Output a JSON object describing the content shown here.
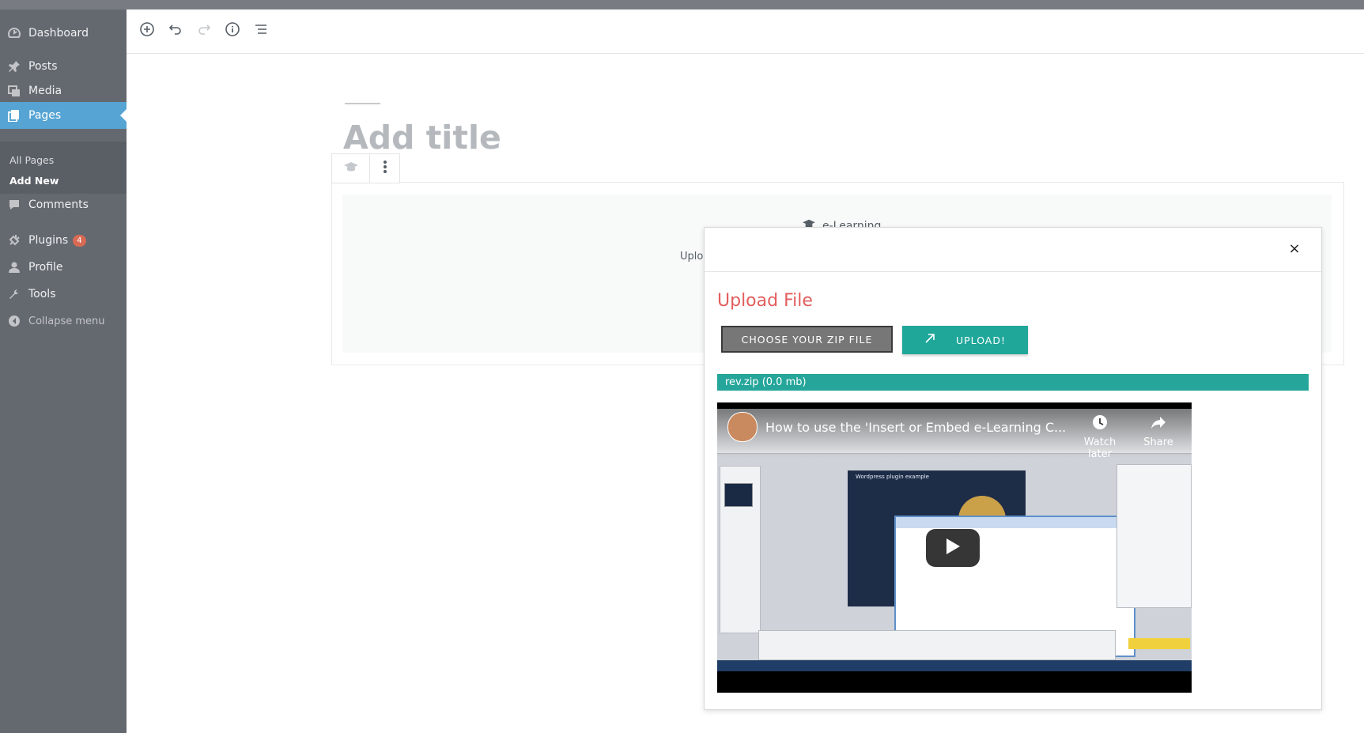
{
  "sidebar": {
    "items": {
      "dashboard": "Dashboard",
      "posts": "Posts",
      "media": "Media",
      "pages": "Pages",
      "comments": "Comments",
      "plugins": "Plugins",
      "profile": "Profile",
      "tools": "Tools"
    },
    "plugins_badge": "4",
    "submenu": {
      "all_pages": "All Pages",
      "add_new": "Add New"
    },
    "collapse_label": "Collapse menu",
    "active_color": "#55a4d3"
  },
  "toolbar": {
    "icons": [
      "plus-circle-icon",
      "undo-icon",
      "redo-icon",
      "info-icon",
      "list-view-icon"
    ]
  },
  "editor": {
    "title_placeholder": "Add title",
    "block_label": "e-Learning",
    "block_upload_text": "Uploa"
  },
  "modal": {
    "close_symbol": "×",
    "title": "Upload File",
    "choose_button": "CHOOSE YOUR ZIP FILE",
    "upload_button": "UPLOAD!",
    "file_status": "rev.zip (0.0 mb)",
    "title_color": "#e35d5d",
    "accent_color": "#1fa79a",
    "video": {
      "title": "How to use the 'Insert or Embed e-Learning C...",
      "watch_later": "Watch later",
      "share": "Share",
      "slide_title": "Wordpress plugin example"
    }
  }
}
